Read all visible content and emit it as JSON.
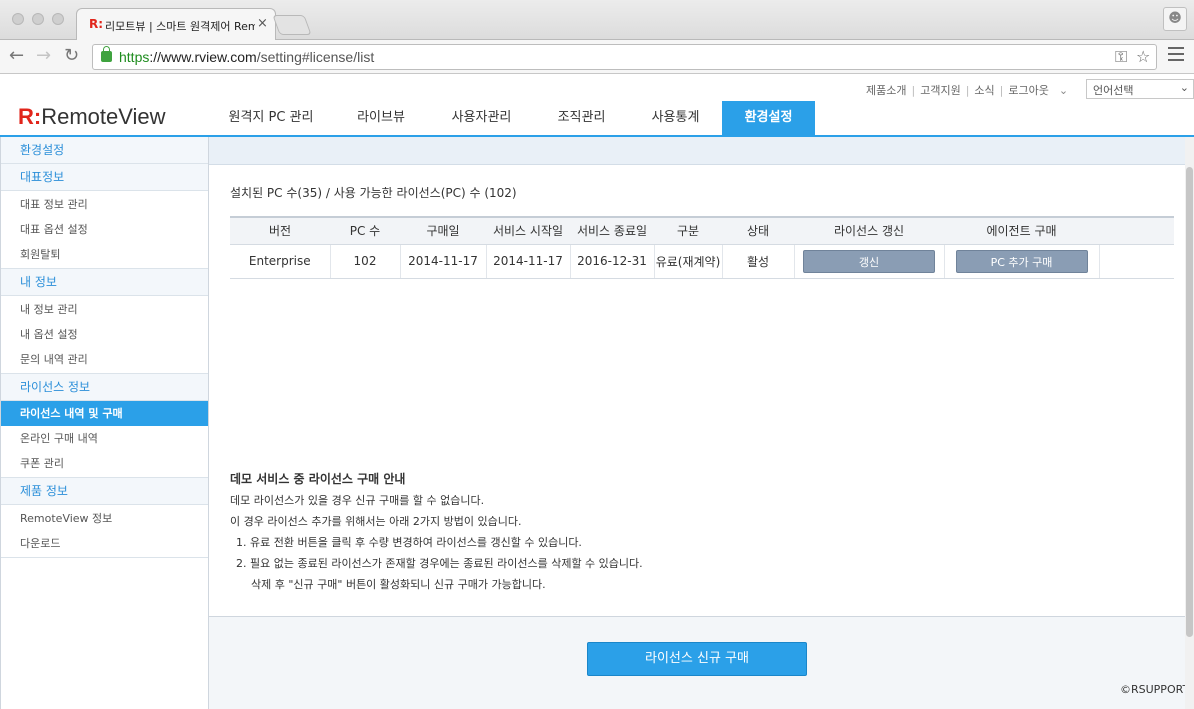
{
  "browser": {
    "tab_favicon": "R:",
    "tab_title": "리모트뷰 | 스마트 원격제어 Rem",
    "tab_close": "×",
    "url_scheme": "https",
    "url_host": "://www.rview.com",
    "url_path": "/setting#license/list",
    "icons": [
      "back-icon",
      "forward-icon",
      "reload-icon",
      "lock-icon",
      "key-icon",
      "star-icon",
      "menu-icon",
      "profile-icon"
    ]
  },
  "header": {
    "logo_mark": "R:",
    "logo_text": "RemoteView",
    "util_links": [
      "제품소개",
      "고객지원",
      "소식",
      "로그아웃"
    ],
    "language_select": "언어선택",
    "nav": [
      "원격지 PC 관리",
      "라이브뷰",
      "사용자관리",
      "조직관리",
      "사용통계",
      "환경설정"
    ],
    "nav_active": "환경설정",
    "accent_color": "#2ba0e8",
    "brand_color": "#e1251b"
  },
  "sidebar": {
    "title": "환경설정",
    "groups": [
      {
        "label": "대표정보",
        "items": [
          "대표 정보 관리",
          "대표 옵션 설정",
          "회원탈퇴"
        ]
      },
      {
        "label": "내 정보",
        "items": [
          "내 정보 관리",
          "내 옵션 설정",
          "문의 내역 관리"
        ]
      },
      {
        "label": "라이선스 정보",
        "items": [
          "라이선스 내역 및 구매",
          "온라인 구매 내역",
          "쿠폰 관리"
        ]
      },
      {
        "label": "제품 정보",
        "items": [
          "RemoteView 정보",
          "다운로드"
        ]
      }
    ],
    "active_item": "라이선스 내역 및 구매"
  },
  "main": {
    "summary": "설치된 PC 수(35) / 사용 가능한 라이선스(PC) 수 (102)",
    "table": {
      "headers": [
        "버전",
        "PC 수",
        "구매일",
        "서비스 시작일",
        "서비스 종료일",
        "구분",
        "상태",
        "라이선스 갱신",
        "에이전트 구매"
      ],
      "rows": [
        {
          "version": "Enterprise",
          "pc_count": "102",
          "purchase_date": "2014-11-17",
          "service_start": "2014-11-17",
          "service_end": "2016-12-31",
          "type": "유료(재계약)",
          "status": "활성",
          "renew_label": "갱신",
          "agent_label": "PC 추가 구매"
        }
      ]
    },
    "guide": {
      "title": "데모 서비스 중 라이선스 구매 안내",
      "lines": [
        "데모 라이선스가 있을 경우 신규 구매를 할 수 없습니다.",
        "이 경우 라이선스 추가를 위해서는 아래 2가지 방법이 있습니다.",
        "1. 유료 전환 버튼을 클릭 후 수량 변경하여 라이선스를 갱신할 수 있습니다.",
        "2. 필요 없는 종료된 라이선스가 존재할 경우에는 종료된 라이선스를 삭제할 수 있습니다.",
        "삭제 후 \"신규 구매\" 버튼이 활성화되니 신규 구매가 가능합니다."
      ]
    },
    "buy_button": "라이선스 신규 구매",
    "copyright": "©RSUPPORT"
  }
}
